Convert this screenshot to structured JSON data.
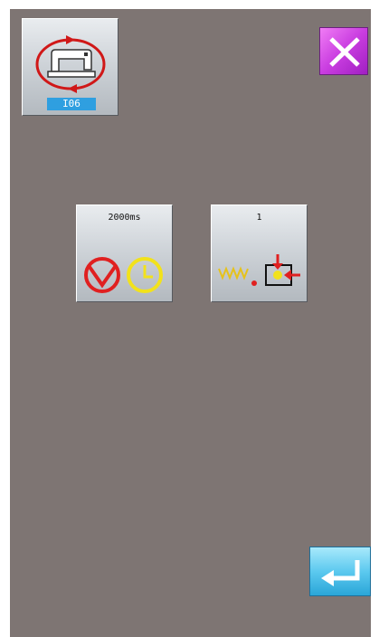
{
  "mode_tile": {
    "label": "I06",
    "icon": "sewing-machine-cycle-icon"
  },
  "close_button": {
    "icon": "close-x-icon",
    "color": "#c93de0"
  },
  "time_tile": {
    "value": "2000ms",
    "icons": [
      "motor-valve-icon",
      "clock-icon"
    ]
  },
  "count_tile": {
    "value": "1",
    "icons": [
      "thread-spring-icon",
      "needle-position-icon"
    ]
  },
  "enter_button": {
    "icon": "enter-return-icon",
    "color": "#5cc9ef"
  },
  "colors": {
    "background": "#7e7573",
    "accent_red": "#e02020",
    "accent_yellow": "#f2e21b"
  }
}
